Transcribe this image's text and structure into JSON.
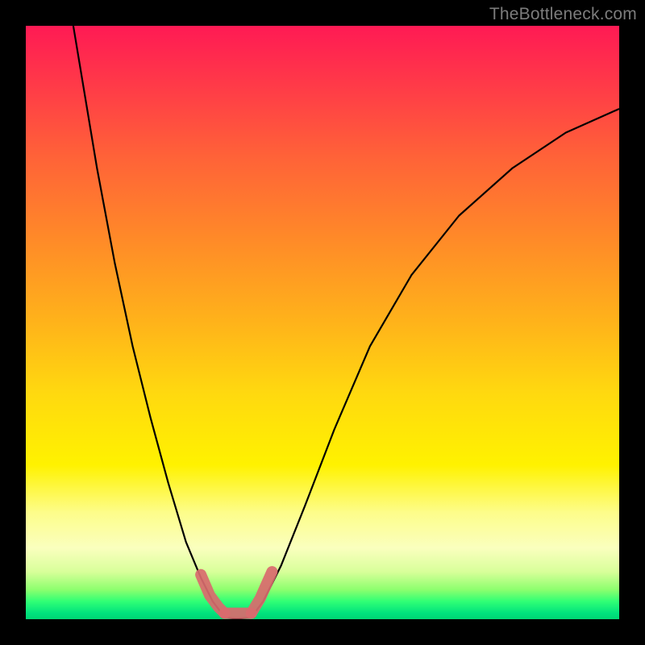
{
  "watermark": "TheBottleneck.com",
  "chart_data": {
    "type": "line",
    "title": "",
    "xlabel": "",
    "ylabel": "",
    "xlim": [
      0,
      100
    ],
    "ylim": [
      0,
      100
    ],
    "grid": false,
    "series": [
      {
        "name": "curve-left",
        "x": [
          8,
          10,
          12,
          15,
          18,
          21,
          24,
          27,
          29.5,
          31.5,
          33
        ],
        "values": [
          100,
          88,
          76,
          60,
          46,
          34,
          23,
          13,
          7,
          3,
          1
        ],
        "color": "#000000"
      },
      {
        "name": "curve-right",
        "x": [
          38.5,
          40,
          43,
          47,
          52,
          58,
          65,
          73,
          82,
          91,
          100
        ],
        "values": [
          1,
          3,
          9,
          19,
          32,
          46,
          58,
          68,
          76,
          82,
          86
        ],
        "color": "#000000"
      },
      {
        "name": "flat-bottom",
        "x": [
          33,
          35.5,
          38.5
        ],
        "values": [
          0.3,
          0.1,
          0.3
        ],
        "color": "#000000"
      },
      {
        "name": "pink-band-left",
        "x": [
          29.5,
          31,
          32.5,
          33.5
        ],
        "values": [
          7.5,
          4,
          2,
          1
        ],
        "color": "#d96a6e"
      },
      {
        "name": "pink-band-bottom",
        "x": [
          33.5,
          35.5,
          38
        ],
        "values": [
          1,
          1,
          1
        ],
        "color": "#d96a6e"
      },
      {
        "name": "pink-band-right",
        "x": [
          38,
          39.5,
          41.5
        ],
        "values": [
          1,
          3.5,
          8
        ],
        "color": "#d96a6e"
      }
    ],
    "annotations": [
      {
        "text": "TheBottleneck.com",
        "position": "top-right"
      }
    ]
  }
}
